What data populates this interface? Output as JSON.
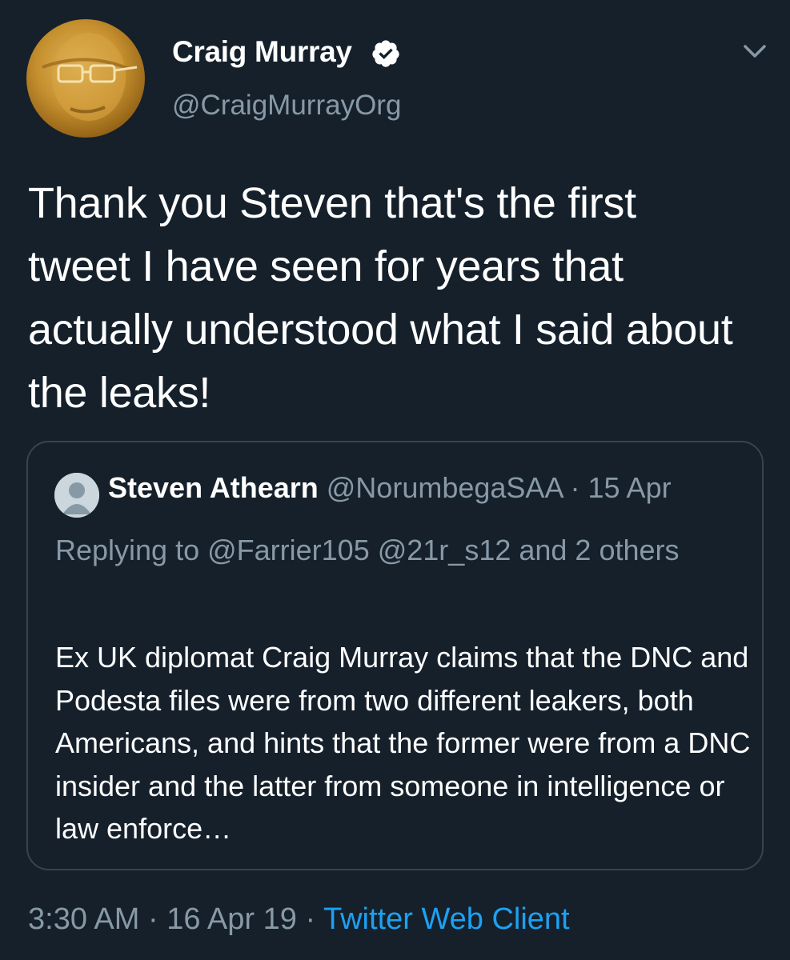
{
  "tweet": {
    "author": {
      "name": "Craig Murray",
      "handle": "@CraigMurrayOrg",
      "verified": true
    },
    "text": "Thank you Steven that's the first tweet I have seen for years that actually understood what I said about the leaks!",
    "time": "3:30 AM",
    "separator": "·",
    "date": "16 Apr 19",
    "client": "Twitter Web Client"
  },
  "quoted": {
    "author_name": "Steven Athearn",
    "author_handle": "@NorumbegaSAA",
    "separator": "·",
    "date": "15 Apr",
    "reply_context": "Replying to @Farrier105 @21r_s12 and 2 others",
    "text": "Ex UK diplomat Craig Murray claims that the DNC and Podesta files were from two different leakers, both Americans, and hints that the former were from a DNC insider and the latter from someone in intelligence or law enforce…"
  },
  "icons": {
    "verified": "verified-badge-icon",
    "menu": "chevron-down-icon",
    "default_avatar": "default-profile-icon"
  },
  "colors": {
    "background": "#15202b",
    "secondary_text": "#8899a6",
    "link": "#1da1f2",
    "border": "#38444d"
  }
}
